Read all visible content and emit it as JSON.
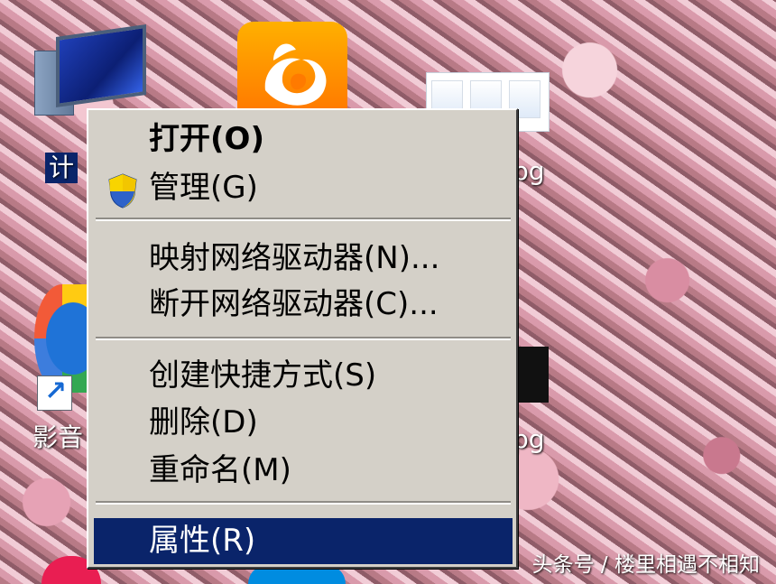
{
  "desktop": {
    "computer_label": "计",
    "media_label": "影音",
    "jpg_label_1": "pg",
    "jpg_label_2": "pg"
  },
  "context_menu": {
    "items": [
      {
        "label": "打开(O)",
        "default": true
      },
      {
        "label": "管理(G)",
        "icon": "shield-icon"
      },
      {
        "label": "映射网络驱动器(N)..."
      },
      {
        "label": "断开网络驱动器(C)..."
      },
      {
        "label": "创建快捷方式(S)"
      },
      {
        "label": "删除(D)"
      },
      {
        "label": "重命名(M)"
      },
      {
        "label": "属性(R)",
        "selected": true
      }
    ]
  },
  "watermark": "头条号 / 楼里相遇不相知",
  "colors": {
    "menu_background": "#d4d0c8",
    "selection": "#0a246a",
    "selection_text": "#ffffff"
  }
}
